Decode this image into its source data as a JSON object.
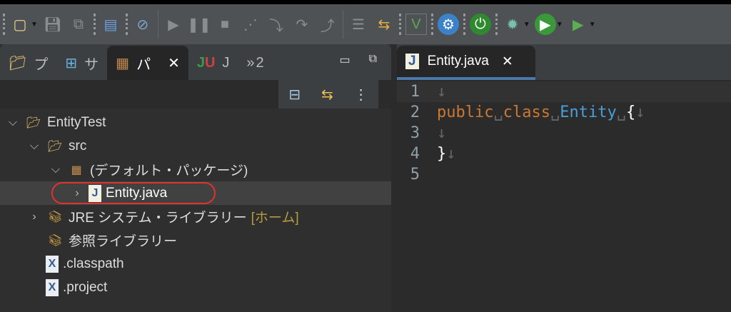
{
  "toolbar": {
    "icons": [
      "new-icon",
      "save-icon",
      "save-all-icon",
      "terminal-icon",
      "skip-breakpoints-icon",
      "resume-icon",
      "suspend-icon",
      "terminate-icon",
      "disconnect-icon",
      "step-into-icon",
      "step-over-icon",
      "step-return-icon",
      "drop-frame-icon",
      "use-step-filters-icon",
      "toggle-vim-icon",
      "settings-icon",
      "spring-boot-icon",
      "debug-icon",
      "run-icon",
      "coverage-icon"
    ]
  },
  "left_panel": {
    "tabs": [
      {
        "label": "プ"
      },
      {
        "label": "サ"
      },
      {
        "label": "パ"
      },
      {
        "label": "J"
      },
      {
        "label": "2",
        "prefix": "»"
      }
    ],
    "tree": [
      {
        "label": "EntityTest",
        "level": 0,
        "expanded": true
      },
      {
        "label": "src",
        "level": 1,
        "expanded": true
      },
      {
        "label": "(デフォルト・パッケージ)",
        "level": 2,
        "expanded": true
      },
      {
        "label": "Entity.java",
        "level": 3,
        "expanded": false
      },
      {
        "label": "JRE システム・ライブラリー",
        "suffix": "[ホーム]",
        "level": 1,
        "expanded": false
      },
      {
        "label": "参照ライブラリー",
        "level": 1
      },
      {
        "label": ".classpath",
        "level": 1
      },
      {
        "label": ".project",
        "level": 1
      }
    ]
  },
  "editor": {
    "tab_label": "Entity.java",
    "line_numbers": [
      "1",
      "2",
      "3",
      "4",
      "5"
    ],
    "code": {
      "kw1": "public",
      "kw2": "class",
      "name": "Entity",
      "open": "{",
      "close": "}",
      "ws": "␣",
      "nl": "↓"
    }
  }
}
